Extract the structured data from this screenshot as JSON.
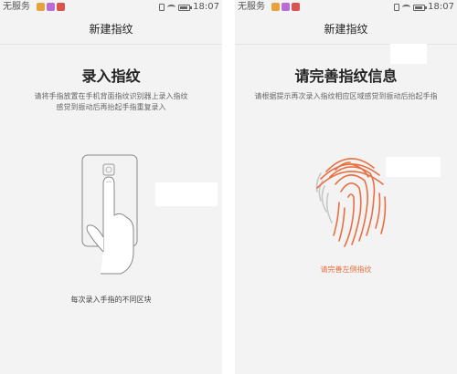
{
  "status_bar": {
    "carrier": "无服务",
    "time": "18:07",
    "app_icon_colors": [
      "#e8a23a",
      "#b96bd6",
      "#d9534f"
    ]
  },
  "left_screen": {
    "title": "新建指纹",
    "heading": "录入指纹",
    "description_line1": "请将手指放置在手机背面指纹识别器上录入指纹",
    "description_line2": "感觉到振动后再抬起手指重复录入",
    "footer": "每次录入手指的不同区块",
    "illustration_icon": "hand-on-phone-icon"
  },
  "right_screen": {
    "title": "新建指纹",
    "heading": "请完善指纹信息",
    "description": "请根据提示再次录入指纹相应区域感觉到振动后抬起手指",
    "hint": "请完善左侧指纹",
    "fingerprint_icon": "fingerprint-icon",
    "accent_color": "#e86f40"
  }
}
